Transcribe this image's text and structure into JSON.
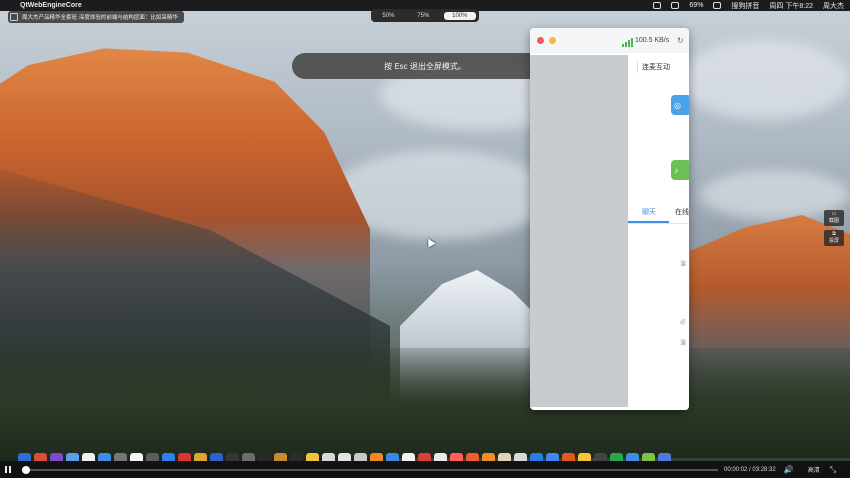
{
  "menubar": {
    "apple_glyph": "",
    "app_name": "QtWebEngineCore",
    "battery": "69%",
    "ime": "搜狗拼音",
    "clock": "周四 下午8:22",
    "user": "周大杰"
  },
  "video_title": "周大杰产品精华全套班·深度体验的前端与结构层面：比如采精华",
  "zoom": {
    "options": [
      "50%",
      "75%",
      "100%"
    ],
    "active": "100%"
  },
  "notice": "按 Esc 退出全屏模式。",
  "app_window": {
    "speed": "100.5 KB/s",
    "refresh_glyph": "↻",
    "tab_interact": "连麦互动",
    "tab_chat": "聊天",
    "tab_online": "在线",
    "faint_text_1": "课",
    "faint_text_2": "必",
    "faint_text_3": "课"
  },
  "side_widgets": [
    {
      "label": "截图"
    },
    {
      "label": "投屏"
    }
  ],
  "player": {
    "progress_fraction": 0.0012,
    "time": "00:00:02 / 03:28:32",
    "volume_glyph": "🔊",
    "quality": "高清",
    "fullscreen_glyph": "⤡"
  },
  "dock_colors": [
    "#2c6fd6",
    "#d84e37",
    "#7b4cc6",
    "#58a0e8",
    "#f0f0f0",
    "#3d8ee6",
    "#777777",
    "#f5f5f5",
    "#5c5c5c",
    "#2e80ec",
    "#d7372e",
    "#e2a32f",
    "#2b63c7",
    "#363636",
    "#6c6c6c",
    "#2a2a2a",
    "#cc8a2e",
    "#2c2c2c",
    "#f3c23c",
    "#d8d8d8",
    "#e5e5e5",
    "#c9c9c9",
    "#f08a24",
    "#3b88e0",
    "#f2f2f2",
    "#d8413a",
    "#eaeaea",
    "#ff5f57",
    "#ee5c2f",
    "#ee8d2a",
    "#e0d3b8",
    "#d8d8d8",
    "#2a7be4",
    "#4285f4",
    "#e05a1f",
    "#f6c33a",
    "#444444",
    "#2ba54c",
    "#3e8edf",
    "#7dc242",
    "#4f7bd8"
  ]
}
